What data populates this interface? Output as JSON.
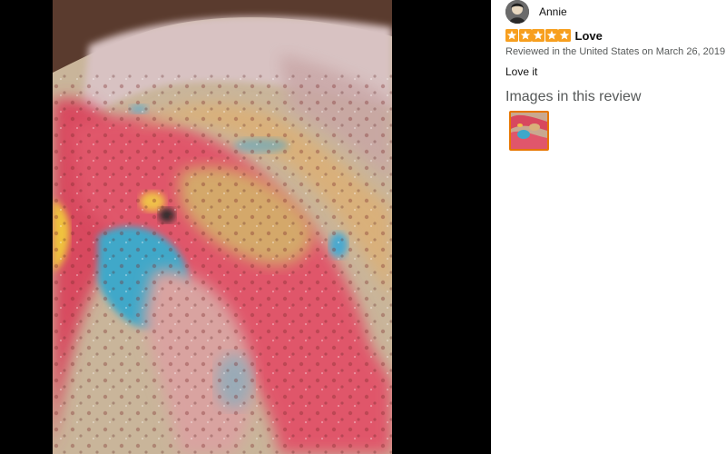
{
  "viewer": {
    "image_alt": "Customer review photo of colorful bath bomb foam"
  },
  "review": {
    "reviewer_name": "Annie",
    "avatar_icon": "user-avatar-icon",
    "rating": 5,
    "rating_max": 5,
    "star_color": "#f79f1f",
    "title": "Love",
    "date_text": "Reviewed in the United States on March 26, 2019",
    "body": "Love it"
  },
  "images": {
    "heading": "Images in this review",
    "selected_border_color": "#e77600"
  }
}
